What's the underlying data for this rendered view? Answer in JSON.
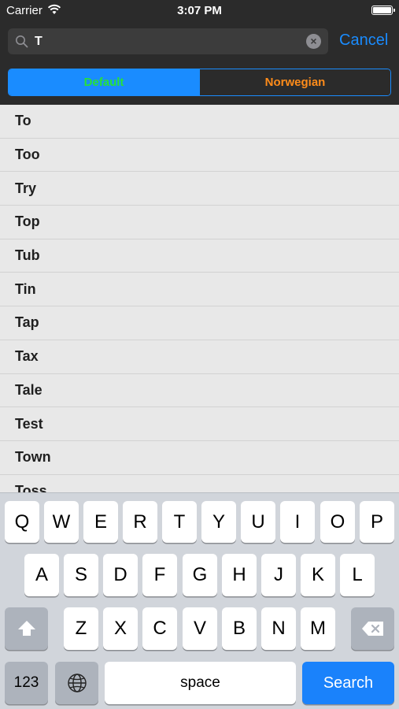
{
  "status_bar": {
    "carrier": "Carrier",
    "time": "3:07 PM"
  },
  "search": {
    "value": "T",
    "cancel_label": "Cancel"
  },
  "segments": [
    {
      "label": "Default",
      "selected": true
    },
    {
      "label": "Norwegian",
      "selected": false
    }
  ],
  "results": [
    "To",
    "Too",
    "Try",
    "Top",
    "Tub",
    "Tin",
    "Tap",
    "Tax",
    "Tale",
    "Test",
    "Town",
    "Toss"
  ],
  "keyboard": {
    "row1": [
      "Q",
      "W",
      "E",
      "R",
      "T",
      "Y",
      "U",
      "I",
      "O",
      "P"
    ],
    "row2": [
      "A",
      "S",
      "D",
      "F",
      "G",
      "H",
      "J",
      "K",
      "L"
    ],
    "row3": [
      "Z",
      "X",
      "C",
      "V",
      "B",
      "N",
      "M"
    ],
    "numbers_label": "123",
    "space_label": "space",
    "search_label": "Search"
  },
  "colors": {
    "accent": "#1a8cff",
    "selected_segment_text": "#27e03a",
    "unselected_segment_text": "#ff8c1a",
    "header_background": "#2b2b2b"
  },
  "icons": [
    "wifi-icon",
    "battery-icon",
    "magnifier-icon",
    "clear-icon",
    "shift-icon",
    "globe-icon",
    "backspace-icon"
  ]
}
